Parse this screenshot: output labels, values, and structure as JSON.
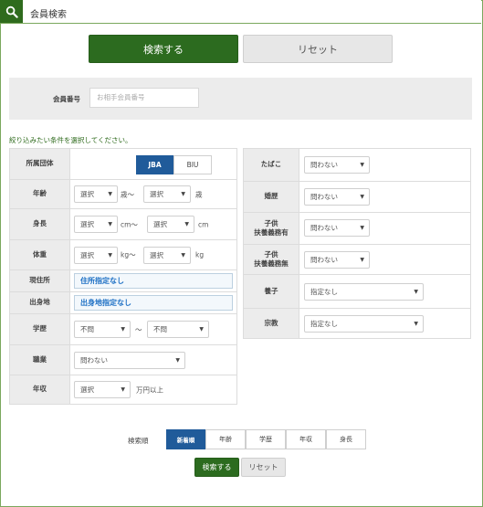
{
  "header": {
    "title": "会員検索",
    "icon": "search-icon"
  },
  "top_actions": {
    "search_label": "検索する",
    "reset_label": "リセット"
  },
  "member_number": {
    "label": "会員番号",
    "placeholder": "お相手会員番号"
  },
  "instruction": "絞り込みたい条件を選択してください。",
  "left": {
    "affiliation": {
      "label": "所属団体",
      "options": [
        "JBA",
        "BIU"
      ],
      "selected": "JBA"
    },
    "age": {
      "label": "年齢",
      "from": "選択",
      "from_unit": "歳〜",
      "to": "選択",
      "to_unit": "歳"
    },
    "height": {
      "label": "身長",
      "from": "選択",
      "from_unit": "cm〜",
      "to": "選択",
      "to_unit": "cm"
    },
    "weight": {
      "label": "体重",
      "from": "選択",
      "from_unit": "kg〜",
      "to": "選択",
      "to_unit": "kg"
    },
    "residence": {
      "label": "現住所",
      "value": "住所指定なし"
    },
    "birthplace": {
      "label": "出身地",
      "value": "出身地指定なし"
    },
    "education": {
      "label": "学歴",
      "from": "不問",
      "separator": "〜",
      "to": "不問"
    },
    "occupation": {
      "label": "職業",
      "value": "問わない"
    },
    "income": {
      "label": "年収",
      "value": "選択",
      "unit": "万円以上"
    }
  },
  "right": {
    "tobacco": {
      "label": "たばこ",
      "value": "問わない"
    },
    "marriage_history": {
      "label": "婚歴",
      "value": "問わない"
    },
    "children_dependent": {
      "label_line1": "子供",
      "label_line2": "扶養義務有",
      "value": "問わない"
    },
    "children_independent": {
      "label_line1": "子供",
      "label_line2": "扶養義務無",
      "value": "問わない"
    },
    "adoption": {
      "label": "養子",
      "value": "指定なし"
    },
    "religion": {
      "label": "宗教",
      "value": "指定なし"
    }
  },
  "sort": {
    "label": "検索順",
    "options": [
      "新着順",
      "年齢",
      "学歴",
      "年収",
      "身長"
    ],
    "selected": "新着順"
  },
  "bottom_actions": {
    "search_label": "検索する",
    "reset_label": "リセット"
  },
  "colors": {
    "brand_green": "#2c6b1f",
    "selected_blue": "#205b9a",
    "link_blue": "#1c6fc4",
    "panel_gray": "#ececec"
  }
}
